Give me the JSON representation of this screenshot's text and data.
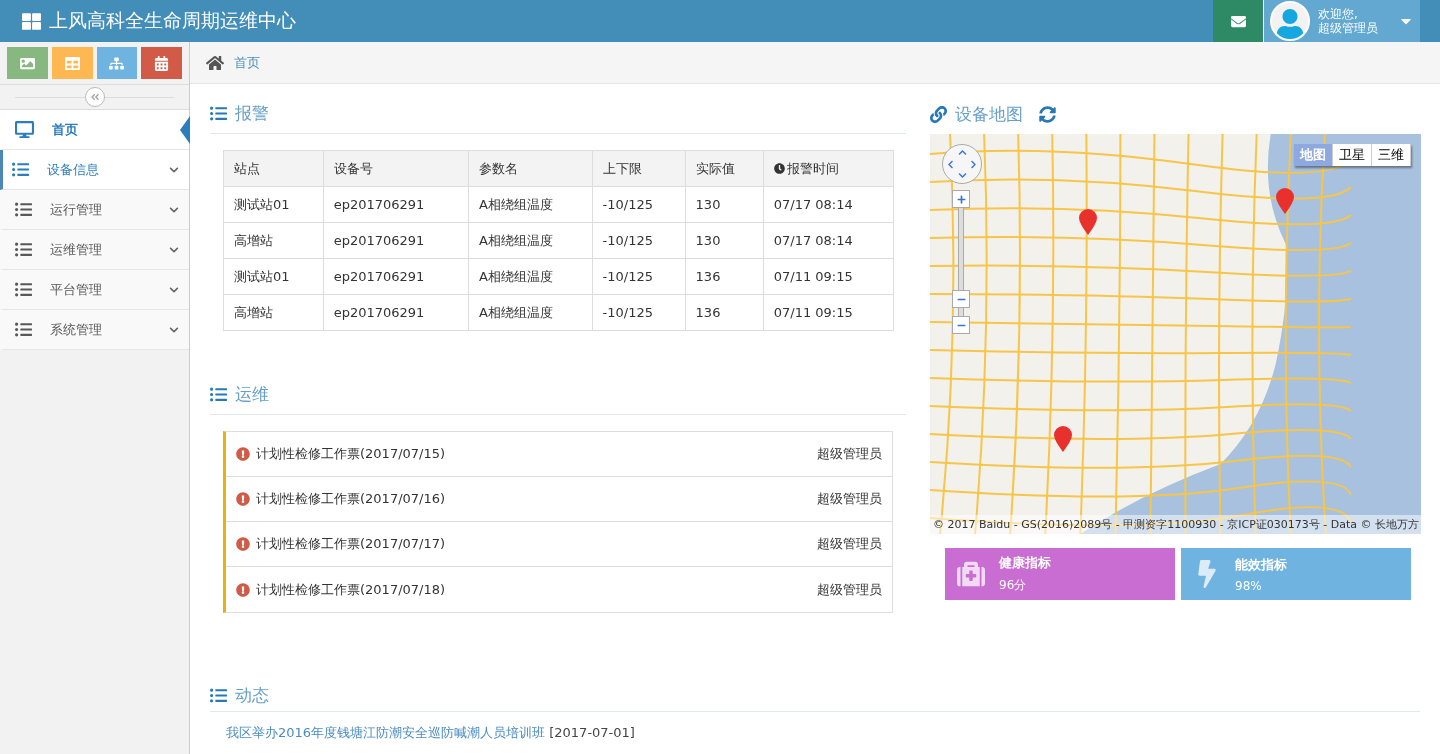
{
  "header": {
    "title": "上风高科全生命周期运维中心",
    "greeting": "欢迎您,",
    "user": "超级管理员"
  },
  "shortcuts": [
    {
      "kind": "picture",
      "color": "#87b87f"
    },
    {
      "kind": "table",
      "color": "#ffb752"
    },
    {
      "kind": "sitemap",
      "color": "#6fb3e0"
    },
    {
      "kind": "calendar",
      "color": "#d15b47"
    }
  ],
  "sidebar": {
    "items": [
      {
        "label": "首页",
        "kind": "desktop",
        "selected": true,
        "highlighted": false,
        "has_children": false
      },
      {
        "label": "设备信息",
        "kind": "list",
        "selected": false,
        "highlighted": true,
        "has_children": true
      },
      {
        "label": "运行管理",
        "kind": "list",
        "selected": false,
        "highlighted": false,
        "has_children": true
      },
      {
        "label": "运维管理",
        "kind": "list",
        "selected": false,
        "highlighted": false,
        "has_children": true
      },
      {
        "label": "平台管理",
        "kind": "list",
        "selected": false,
        "highlighted": false,
        "has_children": true
      },
      {
        "label": "系统管理",
        "kind": "list",
        "selected": false,
        "highlighted": false,
        "has_children": true
      }
    ]
  },
  "breadcrumb": [
    "首页"
  ],
  "alarms": {
    "title": "报警",
    "columns": [
      "站点",
      "设备号",
      "参数名",
      "上下限",
      "实际值",
      "报警时间"
    ],
    "rows": [
      [
        "测试站01",
        "ep201706291",
        "A相绕组温度",
        "-10/125",
        "130",
        "07/17 08:14"
      ],
      [
        "高增站",
        "ep201706291",
        "A相绕组温度",
        "-10/125",
        "130",
        "07/17 08:14"
      ],
      [
        "测试站01",
        "ep201706291",
        "A相绕组温度",
        "-10/125",
        "136",
        "07/11 09:15"
      ],
      [
        "高增站",
        "ep201706291",
        "A相绕组温度",
        "-10/125",
        "136",
        "07/11 09:15"
      ]
    ]
  },
  "maintenance": {
    "title": "运维",
    "items": [
      {
        "text": "计划性检修工作票(2017/07/15)",
        "owner": "超级管理员"
      },
      {
        "text": "计划性检修工作票(2017/07/16)",
        "owner": "超级管理员"
      },
      {
        "text": "计划性检修工作票(2017/07/17)",
        "owner": "超级管理员"
      },
      {
        "text": "计划性检修工作票(2017/07/18)",
        "owner": "超级管理员"
      }
    ]
  },
  "news": {
    "title": "动态",
    "items": [
      {
        "text": "我区举办2016年度钱塘江防潮安全巡防喊潮人员培训班",
        "date": "[2017-07-01]"
      }
    ]
  },
  "map": {
    "title": "设备地图",
    "types": [
      {
        "label": "地图",
        "selected": true
      },
      {
        "label": "卫星",
        "selected": false
      },
      {
        "label": "三维",
        "selected": false
      }
    ],
    "attribution": "© 2017 Baidu - GS(2016)2089号 - 甲测资字1100930 - 京ICP证030173号 - Data © 长地万方"
  },
  "stats": [
    {
      "kind": "health",
      "title": "健康指标",
      "value": "96分",
      "color": "#c96dd3"
    },
    {
      "kind": "energy",
      "title": "能效指标",
      "value": "98%",
      "color": "#6fb3e0"
    }
  ]
}
